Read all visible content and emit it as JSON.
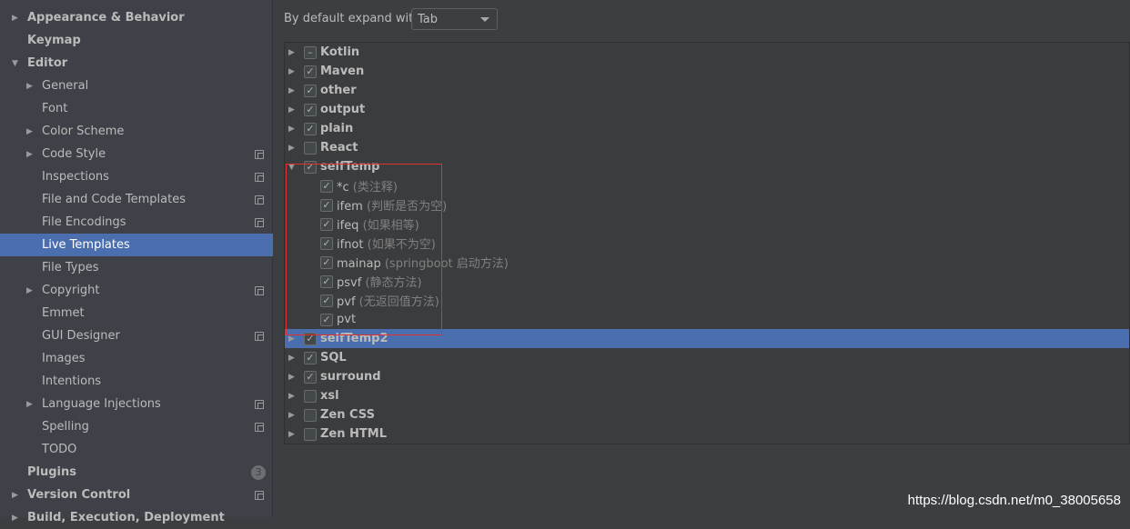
{
  "sidebar": {
    "items": [
      {
        "label": "Appearance & Behavior",
        "level": 0,
        "bold": true,
        "arrow": "right"
      },
      {
        "label": "Keymap",
        "level": 0,
        "bold": true
      },
      {
        "label": "Editor",
        "level": 0,
        "bold": true,
        "arrow": "down"
      },
      {
        "label": "General",
        "level": 1,
        "arrow": "right"
      },
      {
        "label": "Font",
        "level": 1
      },
      {
        "label": "Color Scheme",
        "level": 1,
        "arrow": "right"
      },
      {
        "label": "Code Style",
        "level": 1,
        "arrow": "right",
        "copy": true
      },
      {
        "label": "Inspections",
        "level": 1,
        "copy": true
      },
      {
        "label": "File and Code Templates",
        "level": 1,
        "copy": true
      },
      {
        "label": "File Encodings",
        "level": 1,
        "copy": true
      },
      {
        "label": "Live Templates",
        "level": 1,
        "selected": true
      },
      {
        "label": "File Types",
        "level": 1
      },
      {
        "label": "Copyright",
        "level": 1,
        "arrow": "right",
        "copy": true
      },
      {
        "label": "Emmet",
        "level": 1
      },
      {
        "label": "GUI Designer",
        "level": 1,
        "copy": true
      },
      {
        "label": "Images",
        "level": 1
      },
      {
        "label": "Intentions",
        "level": 1
      },
      {
        "label": "Language Injections",
        "level": 1,
        "arrow": "right",
        "copy": true
      },
      {
        "label": "Spelling",
        "level": 1,
        "copy": true
      },
      {
        "label": "TODO",
        "level": 1
      },
      {
        "label": "Plugins",
        "level": 0,
        "bold": true,
        "badge": "3"
      },
      {
        "label": "Version Control",
        "level": 0,
        "bold": true,
        "arrow": "right",
        "copy": true
      },
      {
        "label": "Build, Execution, Deployment",
        "level": 0,
        "bold": true,
        "arrow": "right"
      }
    ]
  },
  "main": {
    "expand_label": "By default expand with",
    "expand_value": "Tab",
    "tree": [
      {
        "name": "Kotlin",
        "state": "partial",
        "arrow": "right"
      },
      {
        "name": "Maven",
        "state": "checked",
        "arrow": "right"
      },
      {
        "name": "other",
        "state": "checked",
        "arrow": "right"
      },
      {
        "name": "output",
        "state": "checked",
        "arrow": "right"
      },
      {
        "name": "plain",
        "state": "checked",
        "arrow": "right"
      },
      {
        "name": "React",
        "state": "unchecked",
        "arrow": "right"
      },
      {
        "name": "selfTemp",
        "state": "checked",
        "arrow": "down"
      },
      {
        "name": "*c",
        "desc": "(类注释)",
        "state": "checked",
        "child": true
      },
      {
        "name": "ifem",
        "desc": "(判断是否为空)",
        "state": "checked",
        "child": true
      },
      {
        "name": "ifeq",
        "desc": "(如果相等)",
        "state": "checked",
        "child": true
      },
      {
        "name": "ifnot",
        "desc": "(如果不为空)",
        "state": "checked",
        "child": true
      },
      {
        "name": "mainap",
        "desc": "(springboot 启动方法)",
        "state": "checked",
        "child": true
      },
      {
        "name": "psvf",
        "desc": "(静态方法)",
        "state": "checked",
        "child": true
      },
      {
        "name": "pvf",
        "desc": "(无返回值方法)",
        "state": "checked",
        "child": true
      },
      {
        "name": "pvt",
        "state": "checked",
        "child": true
      },
      {
        "name": "selfTemp2",
        "state": "checked",
        "arrow": "right",
        "selected": true
      },
      {
        "name": "SQL",
        "state": "checked",
        "arrow": "right"
      },
      {
        "name": "surround",
        "state": "checked",
        "arrow": "right"
      },
      {
        "name": "xsl",
        "state": "unchecked",
        "arrow": "right"
      },
      {
        "name": "Zen CSS",
        "state": "unchecked",
        "arrow": "right"
      },
      {
        "name": "Zen HTML",
        "state": "unchecked",
        "arrow": "right"
      }
    ]
  },
  "watermark": "https://blog.csdn.net/m0_38005658",
  "colors": {
    "selection": "#4b6eaf",
    "highlight_box": "#e03030"
  }
}
